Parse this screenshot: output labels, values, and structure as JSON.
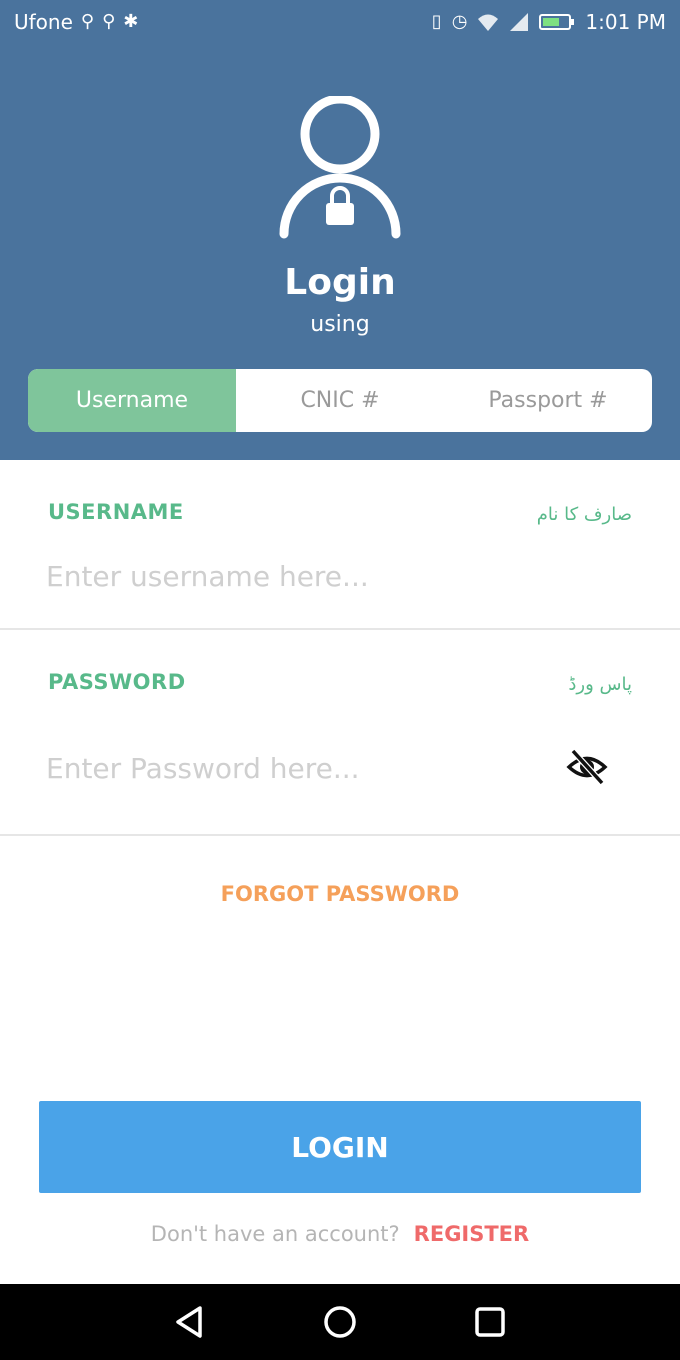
{
  "colors": {
    "header_bg": "#4a739d",
    "tab_active_bg": "#7fc59b",
    "label_green": "#58b98a",
    "forgot_orange": "#f5a05a",
    "login_blue": "#4aa3e8",
    "register_red": "#ef6a6a",
    "nav_bg": "#000000"
  },
  "status_bar": {
    "carrier": "Ufone",
    "left_icons": [
      "usb-icon",
      "usb-icon",
      "android-debug-icon"
    ],
    "right_icons": [
      "vibrate-icon",
      "alarm-icon",
      "wifi-icon",
      "signal-icon",
      "battery-icon"
    ],
    "time": "1:01 PM"
  },
  "header": {
    "icon": "user-lock-icon",
    "title": "Login",
    "subtitle": "using"
  },
  "tabs": [
    {
      "label": "Username",
      "active": true
    },
    {
      "label": "CNIC #",
      "active": false
    },
    {
      "label": "Passport #",
      "active": false
    }
  ],
  "username_field": {
    "label": "USERNAME",
    "label_urdu": "صارف کا نام",
    "placeholder": "Enter username here..."
  },
  "password_field": {
    "label": "PASSWORD",
    "label_urdu": "پاس ورڈ",
    "placeholder": "Enter Password here...",
    "toggle_icon": "eye-off-icon"
  },
  "forgot_password": "FORGOT PASSWORD",
  "login_button": "LOGIN",
  "register": {
    "prompt": "Don't have an account?",
    "link": "REGISTER"
  },
  "nav_bar": [
    "back-icon",
    "home-icon",
    "recents-icon"
  ]
}
